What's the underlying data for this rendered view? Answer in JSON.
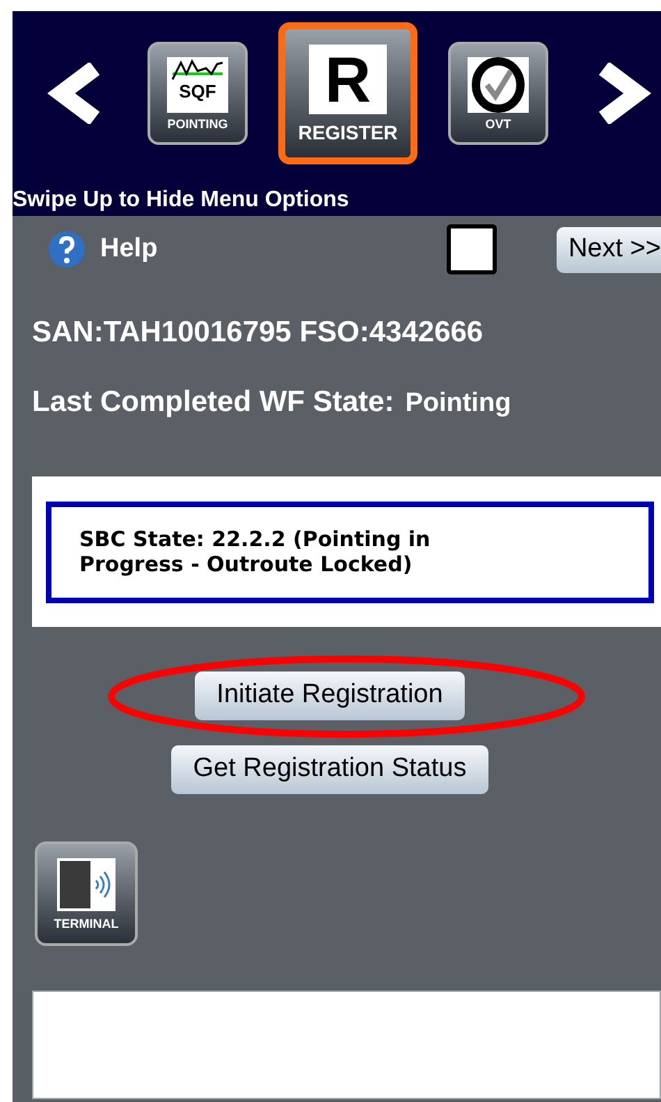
{
  "menu": {
    "tiles": [
      {
        "kind": "chart",
        "glyph": "SQF",
        "label": "POINTING",
        "selected": false
      },
      {
        "kind": "letter",
        "glyph": "R",
        "label": "REGISTER",
        "selected": true
      },
      {
        "kind": "check",
        "label": "OVT",
        "selected": false
      }
    ],
    "hint": "Swipe Up to Hide Menu Options"
  },
  "toolbar": {
    "help": "Help",
    "checkbox": {
      "checked": false
    },
    "next": "Next >>"
  },
  "info": {
    "san": "SAN:TAH10016795 FSO:4342666",
    "wf_label": "Last Completed WF State:",
    "wf_value": "Pointing"
  },
  "status": "SBC State: 22.2.2 (Pointing in Progress - Outroute Locked)",
  "buttons": [
    {
      "label": "Initiate Registration",
      "highlighted": true
    },
    {
      "label": "Get Registration Status",
      "highlighted": false
    }
  ],
  "terminal": {
    "label": "TERMINAL"
  }
}
